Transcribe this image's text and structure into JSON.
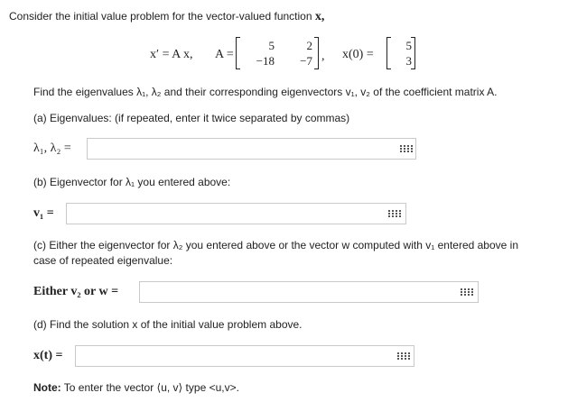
{
  "intro": "Consider the initial value problem for the vector-valued function",
  "intro_var": "x,",
  "equation": {
    "lhs": "x′ = A x,",
    "A_label": "A =",
    "A": [
      "5",
      "2",
      "−18",
      "−7"
    ],
    "comma": ",",
    "x0_label": "x(0) =",
    "x0": [
      "5",
      "3"
    ]
  },
  "find_text": "Find the eigenvalues λ₁, λ₂ and their corresponding eigenvectors v₁, v₂ of the coefficient matrix A.",
  "part_a": {
    "prompt": "(a) Eigenvalues: (if repeated, enter it twice separated by commas)",
    "label": "λ₁, λ₂ ="
  },
  "part_b": {
    "prompt": "(b) Eigenvector for λ₁ you entered above:",
    "label": "v₁ ="
  },
  "part_c": {
    "prompt_line1": "(c) Either the eigenvector for λ₂ you entered above or the vector w computed with v₁ entered above in",
    "prompt_line2": "case of repeated eigenvalue:",
    "label": "Either v₂ or w ="
  },
  "part_d": {
    "prompt": "(d) Find the solution x of the initial value problem above.",
    "label": "x(t) ="
  },
  "note": {
    "bold": "Note:",
    "text": "To enter the vector ⟨u, v⟩ type <u,v>."
  },
  "icons": {
    "equation_editor": "grid-icon"
  }
}
